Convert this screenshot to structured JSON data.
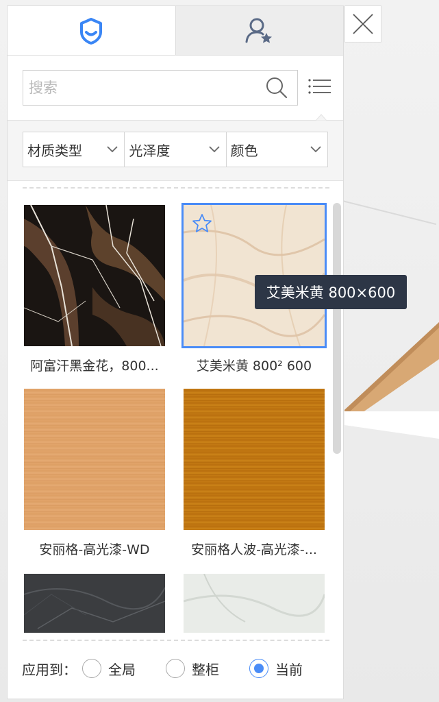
{
  "tabs": [
    {
      "icon": "shield-smile-icon",
      "active": true
    },
    {
      "icon": "user-star-icon",
      "active": false
    }
  ],
  "search": {
    "placeholder": "搜索",
    "value": ""
  },
  "filters": [
    {
      "label": "材质类型"
    },
    {
      "label": "光泽度"
    },
    {
      "label": "颜色"
    }
  ],
  "materials": [
    {
      "name": "阿富汗黑金花，800...",
      "texture": "black-gold-marble"
    },
    {
      "name": "艾美米黄 800² 600",
      "texture": "beige-marble",
      "selected": true,
      "favorite_icon": "star-outline-icon"
    },
    {
      "name": "安丽格-高光漆-WD",
      "texture": "light-wood"
    },
    {
      "name": "安丽格人波-高光漆-...",
      "texture": "golden-wood"
    },
    {
      "name": "",
      "texture": "dark-grey-marble"
    },
    {
      "name": "",
      "texture": "white-marble"
    }
  ],
  "tooltip": {
    "text": "艾美米黄 800×600"
  },
  "apply": {
    "label": "应用到：",
    "options": [
      {
        "label": "全局",
        "checked": false
      },
      {
        "label": "整柜",
        "checked": false
      },
      {
        "label": "当前",
        "checked": true
      }
    ]
  },
  "colors": {
    "accent": "#4a8cf7",
    "tooltip_bg": "#2d3646"
  }
}
